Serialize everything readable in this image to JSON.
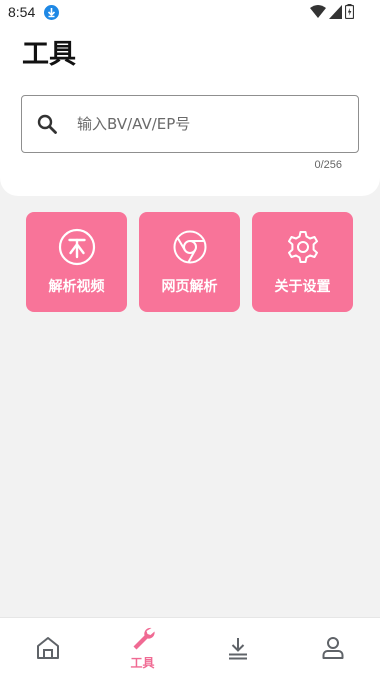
{
  "status_bar": {
    "time": "8:54"
  },
  "page": {
    "title": "工具"
  },
  "search": {
    "placeholder": "输入BV/AV/EP号",
    "value": "",
    "counter": "0/256"
  },
  "tools": [
    {
      "label": "解析视频",
      "icon": "coin-icon"
    },
    {
      "label": "网页解析",
      "icon": "chrome-icon"
    },
    {
      "label": "关于设置",
      "icon": "gear-icon"
    }
  ],
  "bottom_nav": {
    "items": [
      {
        "label": "",
        "icon": "home-icon",
        "active": false
      },
      {
        "label": "工具",
        "icon": "wrench-icon",
        "active": true
      },
      {
        "label": "",
        "icon": "download-icon",
        "active": false
      },
      {
        "label": "",
        "icon": "profile-icon",
        "active": false
      }
    ]
  },
  "colors": {
    "accent": "#f87499",
    "nav_active": "#f06a93",
    "nav_inactive": "#5f6368",
    "background": "#f2f2f2"
  }
}
